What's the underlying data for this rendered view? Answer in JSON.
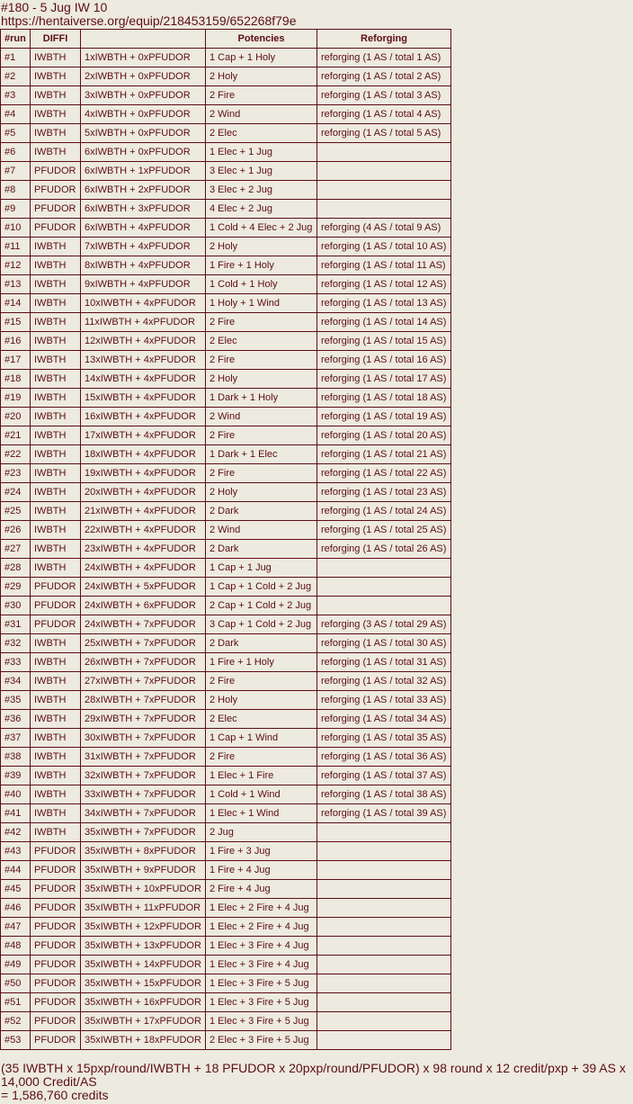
{
  "header": {
    "title": "#180 - 5 Jug IW 10",
    "url": "https://hentaiverse.org/equip/218453159/652268f79e"
  },
  "table": {
    "columns": [
      "#run",
      "DIFFI",
      "",
      "Potencies",
      "Reforging"
    ],
    "rows": [
      [
        "#1",
        "IWBTH",
        "1xIWBTH + 0xPFUDOR",
        "1 Cap + 1 Holy",
        "reforging (1 AS / total 1 AS)"
      ],
      [
        "#2",
        "IWBTH",
        "2xIWBTH + 0xPFUDOR",
        "2 Holy",
        "reforging (1 AS / total 2 AS)"
      ],
      [
        "#3",
        "IWBTH",
        "3xIWBTH + 0xPFUDOR",
        "2 Fire",
        "reforging (1 AS / total 3 AS)"
      ],
      [
        "#4",
        "IWBTH",
        "4xIWBTH + 0xPFUDOR",
        "2 Wind",
        "reforging (1 AS / total 4 AS)"
      ],
      [
        "#5",
        "IWBTH",
        "5xIWBTH + 0xPFUDOR",
        "2 Elec",
        "reforging (1 AS / total 5 AS)"
      ],
      [
        "#6",
        "IWBTH",
        "6xIWBTH + 0xPFUDOR",
        "1 Elec + 1 Jug",
        ""
      ],
      [
        "#7",
        "PFUDOR",
        "6xIWBTH + 1xPFUDOR",
        "3 Elec + 1 Jug",
        ""
      ],
      [
        "#8",
        "PFUDOR",
        "6xIWBTH + 2xPFUDOR",
        "3 Elec + 2 Jug",
        ""
      ],
      [
        "#9",
        "PFUDOR",
        "6xIWBTH + 3xPFUDOR",
        "4 Elec + 2 Jug",
        ""
      ],
      [
        "#10",
        "PFUDOR",
        "6xIWBTH + 4xPFUDOR",
        "1 Cold + 4 Elec + 2 Jug",
        "reforging (4 AS / total 9 AS)"
      ],
      [
        "#11",
        "IWBTH",
        "7xIWBTH + 4xPFUDOR",
        "2 Holy",
        "reforging (1 AS / total 10 AS)"
      ],
      [
        "#12",
        "IWBTH",
        "8xIWBTH + 4xPFUDOR",
        "1 Fire + 1 Holy",
        "reforging (1 AS / total 11 AS)"
      ],
      [
        "#13",
        "IWBTH",
        "9xIWBTH + 4xPFUDOR",
        "1 Cold + 1 Holy",
        "reforging (1 AS / total 12 AS)"
      ],
      [
        "#14",
        "IWBTH",
        "10xIWBTH + 4xPFUDOR",
        "1 Holy + 1 Wind",
        "reforging (1 AS / total 13 AS)"
      ],
      [
        "#15",
        "IWBTH",
        "11xIWBTH + 4xPFUDOR",
        "2 Fire",
        "reforging (1 AS / total 14 AS)"
      ],
      [
        "#16",
        "IWBTH",
        "12xIWBTH + 4xPFUDOR",
        "2 Elec",
        "reforging (1 AS / total 15 AS)"
      ],
      [
        "#17",
        "IWBTH",
        "13xIWBTH + 4xPFUDOR",
        "2 Fire",
        "reforging (1 AS / total 16 AS)"
      ],
      [
        "#18",
        "IWBTH",
        "14xIWBTH + 4xPFUDOR",
        "2 Holy",
        "reforging (1 AS / total 17 AS)"
      ],
      [
        "#19",
        "IWBTH",
        "15xIWBTH + 4xPFUDOR",
        "1 Dark + 1 Holy",
        "reforging (1 AS / total 18 AS)"
      ],
      [
        "#20",
        "IWBTH",
        "16xIWBTH + 4xPFUDOR",
        "2 Wind",
        "reforging (1 AS / total 19 AS)"
      ],
      [
        "#21",
        "IWBTH",
        "17xIWBTH + 4xPFUDOR",
        "2 Fire",
        "reforging (1 AS / total 20 AS)"
      ],
      [
        "#22",
        "IWBTH",
        "18xIWBTH + 4xPFUDOR",
        "1 Dark + 1 Elec",
        "reforging (1 AS / total 21 AS)"
      ],
      [
        "#23",
        "IWBTH",
        "19xIWBTH + 4xPFUDOR",
        "2 Fire",
        "reforging (1 AS / total 22 AS)"
      ],
      [
        "#24",
        "IWBTH",
        "20xIWBTH + 4xPFUDOR",
        "2 Holy",
        "reforging (1 AS / total 23 AS)"
      ],
      [
        "#25",
        "IWBTH",
        "21xIWBTH + 4xPFUDOR",
        "2 Dark",
        "reforging (1 AS / total 24 AS)"
      ],
      [
        "#26",
        "IWBTH",
        "22xIWBTH + 4xPFUDOR",
        "2 Wind",
        "reforging (1 AS / total 25 AS)"
      ],
      [
        "#27",
        "IWBTH",
        "23xIWBTH + 4xPFUDOR",
        "2 Dark",
        "reforging (1 AS / total 26 AS)"
      ],
      [
        "#28",
        "IWBTH",
        "24xIWBTH + 4xPFUDOR",
        "1 Cap + 1 Jug",
        ""
      ],
      [
        "#29",
        "PFUDOR",
        "24xIWBTH + 5xPFUDOR",
        "1 Cap + 1 Cold + 2 Jug",
        ""
      ],
      [
        "#30",
        "PFUDOR",
        "24xIWBTH + 6xPFUDOR",
        "2 Cap + 1 Cold + 2 Jug",
        ""
      ],
      [
        "#31",
        "PFUDOR",
        "24xIWBTH + 7xPFUDOR",
        "3 Cap + 1 Cold + 2 Jug",
        "reforging (3 AS / total 29 AS)"
      ],
      [
        "#32",
        "IWBTH",
        "25xIWBTH + 7xPFUDOR",
        "2 Dark",
        "reforging (1 AS / total 30 AS)"
      ],
      [
        "#33",
        "IWBTH",
        "26xIWBTH + 7xPFUDOR",
        "1 Fire + 1 Holy",
        "reforging (1 AS / total 31 AS)"
      ],
      [
        "#34",
        "IWBTH",
        "27xIWBTH + 7xPFUDOR",
        "2 Fire",
        "reforging (1 AS / total 32 AS)"
      ],
      [
        "#35",
        "IWBTH",
        "28xIWBTH + 7xPFUDOR",
        "2 Holy",
        "reforging (1 AS / total 33 AS)"
      ],
      [
        "#36",
        "IWBTH",
        "29xIWBTH + 7xPFUDOR",
        "2 Elec",
        "reforging (1 AS / total 34 AS)"
      ],
      [
        "#37",
        "IWBTH",
        "30xIWBTH + 7xPFUDOR",
        "1 Cap + 1 Wind",
        "reforging (1 AS / total 35 AS)"
      ],
      [
        "#38",
        "IWBTH",
        "31xIWBTH + 7xPFUDOR",
        "2 Fire",
        "reforging (1 AS / total 36 AS)"
      ],
      [
        "#39",
        "IWBTH",
        "32xIWBTH + 7xPFUDOR",
        "1 Elec + 1 Fire",
        "reforging (1 AS / total 37 AS)"
      ],
      [
        "#40",
        "IWBTH",
        "33xIWBTH + 7xPFUDOR",
        "1 Cold + 1 Wind",
        "reforging (1 AS / total 38 AS)"
      ],
      [
        "#41",
        "IWBTH",
        "34xIWBTH + 7xPFUDOR",
        "1 Elec + 1 Wind",
        "reforging (1 AS / total 39 AS)"
      ],
      [
        "#42",
        "IWBTH",
        "35xIWBTH + 7xPFUDOR",
        "2 Jug",
        ""
      ],
      [
        "#43",
        "PFUDOR",
        "35xIWBTH + 8xPFUDOR",
        "1 Fire + 3 Jug",
        ""
      ],
      [
        "#44",
        "PFUDOR",
        "35xIWBTH + 9xPFUDOR",
        "1 Fire + 4 Jug",
        ""
      ],
      [
        "#45",
        "PFUDOR",
        "35xIWBTH + 10xPFUDOR",
        "2 Fire + 4 Jug",
        ""
      ],
      [
        "#46",
        "PFUDOR",
        "35xIWBTH + 11xPFUDOR",
        "1 Elec + 2 Fire + 4 Jug",
        ""
      ],
      [
        "#47",
        "PFUDOR",
        "35xIWBTH + 12xPFUDOR",
        "1 Elec + 2 Fire + 4 Jug",
        ""
      ],
      [
        "#48",
        "PFUDOR",
        "35xIWBTH + 13xPFUDOR",
        "1 Elec + 3 Fire + 4 Jug",
        ""
      ],
      [
        "#49",
        "PFUDOR",
        "35xIWBTH + 14xPFUDOR",
        "1 Elec + 3 Fire + 4 Jug",
        ""
      ],
      [
        "#50",
        "PFUDOR",
        "35xIWBTH + 15xPFUDOR",
        "1 Elec + 3 Fire + 5 Jug",
        ""
      ],
      [
        "#51",
        "PFUDOR",
        "35xIWBTH + 16xPFUDOR",
        "1 Elec + 3 Fire + 5 Jug",
        ""
      ],
      [
        "#52",
        "PFUDOR",
        "35xIWBTH + 17xPFUDOR",
        "1 Elec + 3 Fire + 5 Jug",
        ""
      ],
      [
        "#53",
        "PFUDOR",
        "35xIWBTH + 18xPFUDOR",
        "2 Elec + 3 Fire + 5 Jug",
        ""
      ]
    ]
  },
  "footer": {
    "formula": "(35 IWBTH x 15pxp/round/IWBTH + 18 PFUDOR x 20pxp/round/PFUDOR) x 98 round x 12 credit/pxp + 39 AS x 14,000 Credit/AS",
    "result": "= 1,586,760 credits"
  },
  "colors": {
    "background": "#edeae0",
    "text": "#5c0d11",
    "border": "#5c0d11"
  }
}
